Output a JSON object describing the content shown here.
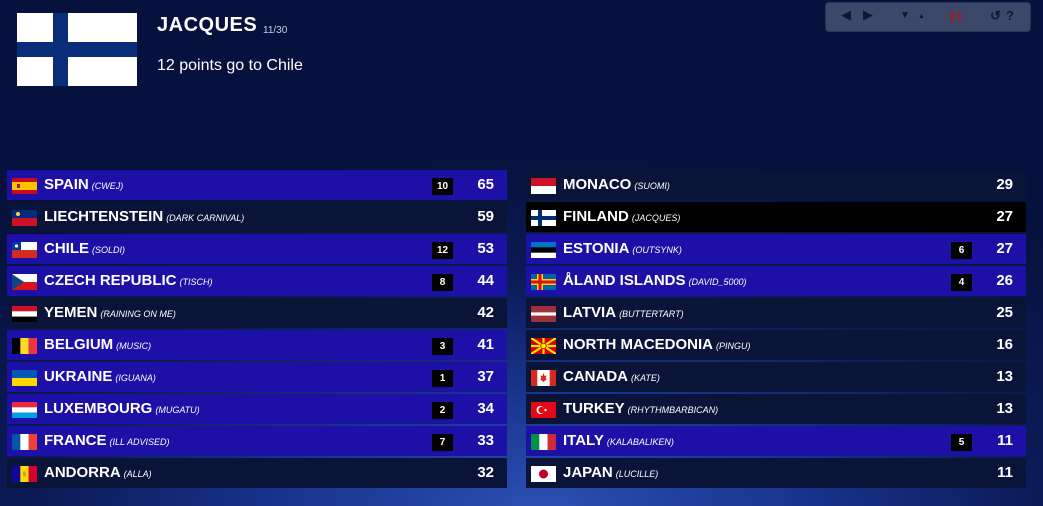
{
  "header": {
    "juror": "JACQUES",
    "progress": "11/30",
    "announcement": "12 points go to Chile",
    "flag_icon": "finland-flag"
  },
  "controls": {
    "prev": "◀",
    "next": "▶",
    "down": "▼",
    "up": "▲",
    "reset": "↺",
    "help": "?"
  },
  "left_rows": [
    {
      "country": "SPAIN",
      "user": "(CWEJ)",
      "points": "10",
      "total": "65",
      "flag": "spain",
      "style": "c0"
    },
    {
      "country": "LIECHTENSTEIN",
      "user": "(DARK CARNIVAL)",
      "points": "",
      "total": "59",
      "flag": "liechtenstein",
      "style": "c1"
    },
    {
      "country": "CHILE",
      "user": "(SOLDI)",
      "points": "12",
      "total": "53",
      "flag": "chile",
      "style": "c0"
    },
    {
      "country": "CZECH REPUBLIC",
      "user": "(TISCH)",
      "points": "8",
      "total": "44",
      "flag": "czech",
      "style": "c0"
    },
    {
      "country": "YEMEN",
      "user": "(RAINING ON ME)",
      "points": "",
      "total": "42",
      "flag": "yemen",
      "style": "c1"
    },
    {
      "country": "BELGIUM",
      "user": "(MUSIC)",
      "points": "3",
      "total": "41",
      "flag": "belgium",
      "style": "c0"
    },
    {
      "country": "UKRAINE",
      "user": "(IGUANA)",
      "points": "1",
      "total": "37",
      "flag": "ukraine",
      "style": "c0"
    },
    {
      "country": "LUXEMBOURG",
      "user": "(MUGATU)",
      "points": "2",
      "total": "34",
      "flag": "luxembourg",
      "style": "c0"
    },
    {
      "country": "FRANCE",
      "user": "(ILL ADVISED)",
      "points": "7",
      "total": "33",
      "flag": "france",
      "style": "c0"
    },
    {
      "country": "ANDORRA",
      "user": "(ALLA)",
      "points": "",
      "total": "32",
      "flag": "andorra",
      "style": "c1"
    }
  ],
  "right_rows": [
    {
      "country": "MONACO",
      "user": "(SUOMI)",
      "points": "",
      "total": "29",
      "flag": "monaco",
      "style": "c1"
    },
    {
      "country": "FINLAND",
      "user": "(JACQUES)",
      "points": "",
      "total": "27",
      "flag": "finland",
      "style": "cur"
    },
    {
      "country": "ESTONIA",
      "user": "(OUTSYNK)",
      "points": "6",
      "total": "27",
      "flag": "estonia",
      "style": "c0"
    },
    {
      "country": "ÅLAND ISLANDS",
      "user": "(DAVID_5000)",
      "points": "4",
      "total": "26",
      "flag": "aland",
      "style": "c0"
    },
    {
      "country": "LATVIA",
      "user": "(BUTTERTART)",
      "points": "",
      "total": "25",
      "flag": "latvia",
      "style": "c1"
    },
    {
      "country": "NORTH MACEDONIA",
      "user": "(PINGU)",
      "points": "",
      "total": "16",
      "flag": "macedonia",
      "style": "c1"
    },
    {
      "country": "CANADA",
      "user": "(KATE)",
      "points": "",
      "total": "13",
      "flag": "canada",
      "style": "c1"
    },
    {
      "country": "TURKEY",
      "user": "(RHYTHMBARBICAN)",
      "points": "",
      "total": "13",
      "flag": "turkey",
      "style": "c1"
    },
    {
      "country": "ITALY",
      "user": "(KALABALIKEN)",
      "points": "5",
      "total": "11",
      "flag": "italy",
      "style": "c0"
    },
    {
      "country": "JAPAN",
      "user": "(LUCILLE)",
      "points": "",
      "total": "11",
      "flag": "japan",
      "style": "c1"
    }
  ]
}
